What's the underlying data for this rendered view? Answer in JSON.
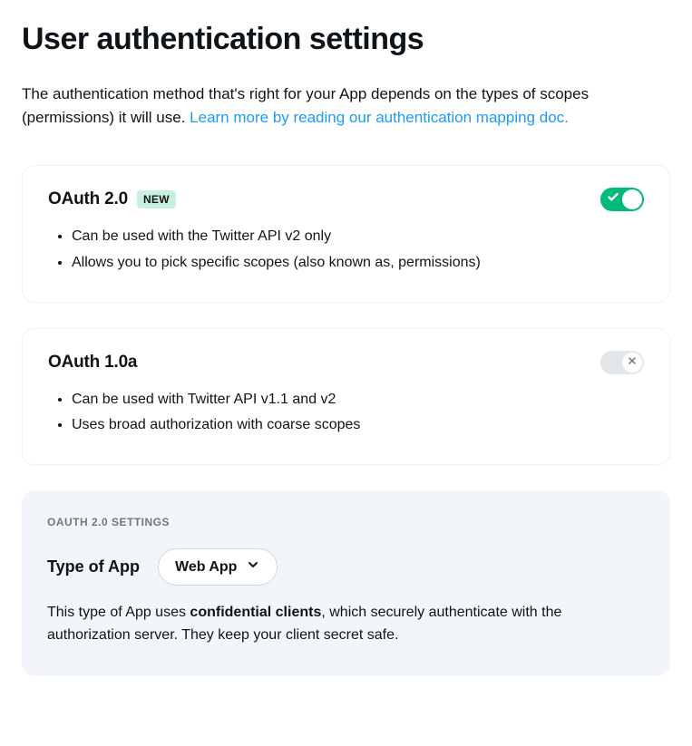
{
  "page": {
    "title": "User authentication settings",
    "intro_text": "The authentication method that's right for your App depends on the types of scopes (permissions) it will use.   ",
    "intro_link": "Learn more by reading our authentication mapping doc."
  },
  "oauth2": {
    "title": "OAuth 2.0",
    "badge": "NEW",
    "enabled": true,
    "features": [
      "Can be used with the Twitter API v2 only",
      "Allows you to pick specific scopes (also known as, permissions)"
    ]
  },
  "oauth1": {
    "title": "OAuth 1.0a",
    "enabled": false,
    "features": [
      "Can be used with Twitter API v1.1 and v2",
      "Uses broad authorization with coarse scopes"
    ]
  },
  "settings": {
    "section_label": "OAUTH 2.0 SETTINGS",
    "type_label": "Type of App",
    "selected_type": "Web App",
    "desc_prefix": "This type of App uses ",
    "desc_bold": "confidential clients",
    "desc_suffix": ", which securely authenticate with the authorization server. They keep your client secret safe."
  }
}
